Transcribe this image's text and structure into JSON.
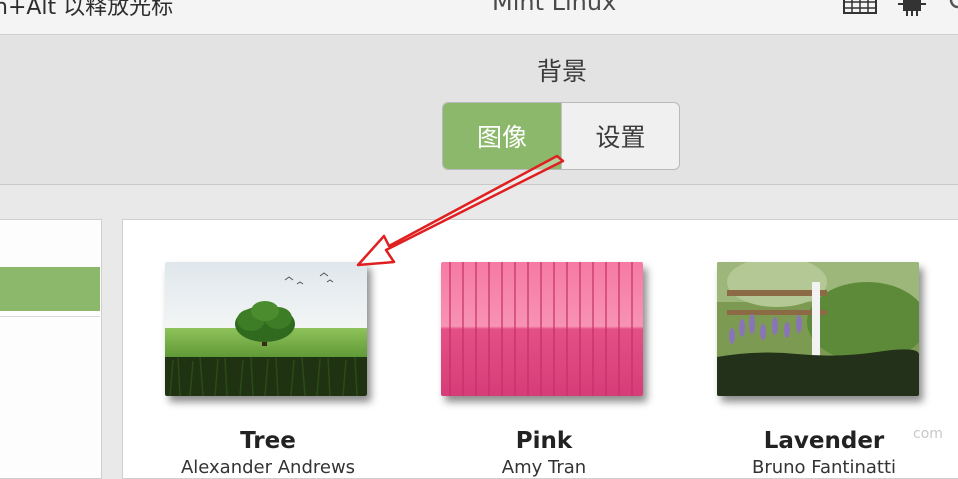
{
  "host": {
    "hint_text": "n+Alt 以释放光标",
    "vm_title": "Mint Linux"
  },
  "window": {
    "title": "背景",
    "tabs": [
      {
        "label": "图像",
        "active": true
      },
      {
        "label": "设置",
        "active": false
      }
    ]
  },
  "wallpapers": [
    {
      "name": "Tree",
      "author": "Alexander Andrews"
    },
    {
      "name": "Pink",
      "author": "Amy Tran"
    },
    {
      "name": "Lavender",
      "author": "Bruno Fantinatti"
    }
  ],
  "colors": {
    "accent": "#8bb86a",
    "annotation_arrow": "#e02020"
  },
  "watermark": "com"
}
